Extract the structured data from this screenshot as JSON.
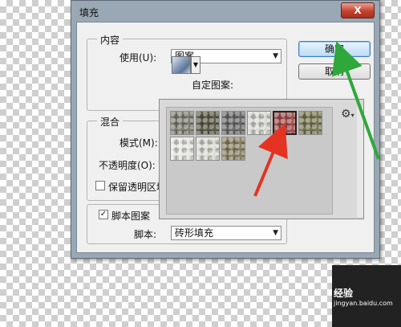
{
  "dialog": {
    "title": "填充",
    "close_label": "X"
  },
  "content_group": {
    "legend": "内容",
    "use_label": "使用(U):",
    "use_value": "图案",
    "custom_pattern_label": "自定图案:"
  },
  "blend_group": {
    "legend": "混合",
    "mode_label": "模式(M):",
    "opacity_label": "不透明度(O):",
    "preserve_label": "保留透明区域"
  },
  "script_group": {
    "checkbox_label": "脚本图案",
    "script_label": "脚本:",
    "script_value": "砖形填充"
  },
  "buttons": {
    "ok": "确定",
    "cancel": "取消"
  },
  "pattern_picker": {
    "menu_icon": "gear-icon",
    "patterns": [
      {
        "name": "pattern-1",
        "color": "#7f7f72"
      },
      {
        "name": "pattern-2",
        "color": "#5e5b48"
      },
      {
        "name": "pattern-3",
        "color": "#6b6b6b"
      },
      {
        "name": "pattern-4",
        "color": "#d8d8d2"
      },
      {
        "name": "pattern-5",
        "color": "#a55252"
      },
      {
        "name": "pattern-6",
        "color": "#7b7a55"
      },
      {
        "name": "pattern-7",
        "color": "#e6e6e2"
      },
      {
        "name": "pattern-8",
        "color": "#dcdcd4"
      },
      {
        "name": "pattern-9",
        "color": "#8c8366"
      }
    ],
    "selected_index": 4
  },
  "watermark": {
    "text": "经验",
    "sub": "jingyan.baidu.com"
  },
  "annotation_colors": {
    "red_arrow": "#e53323",
    "green_arrow": "#2ea83a"
  }
}
